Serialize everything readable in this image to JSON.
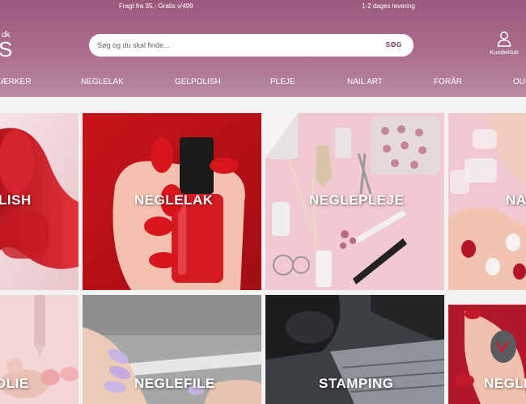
{
  "topbar": {
    "shipping_text": "Fragt fra 35,- Gratis v/499",
    "delivery_text": "1-2 dages levering"
  },
  "logo": {
    "small_text": "dk",
    "big_text": "S"
  },
  "search": {
    "placeholder": "Søg og du skal finde...",
    "button_label": "SØG"
  },
  "account": {
    "label": "Kundeklub",
    "icon": "user-icon"
  },
  "nav": {
    "items": [
      "VÆRKER",
      "NEGLELAK",
      "GELPOLISH",
      "PLEJE",
      "NAIL ART",
      "FORÅR",
      "OU"
    ]
  },
  "categories": {
    "row1": [
      "LISH",
      "NEGLELAK",
      "NEGLEPLEJE",
      "NA"
    ],
    "row2": [
      "OLIE",
      "NEGLEFILE",
      "STAMPING",
      "NEGLE"
    ]
  },
  "colors": {
    "header": "#a8698a",
    "accent": "#7a3b5e"
  }
}
